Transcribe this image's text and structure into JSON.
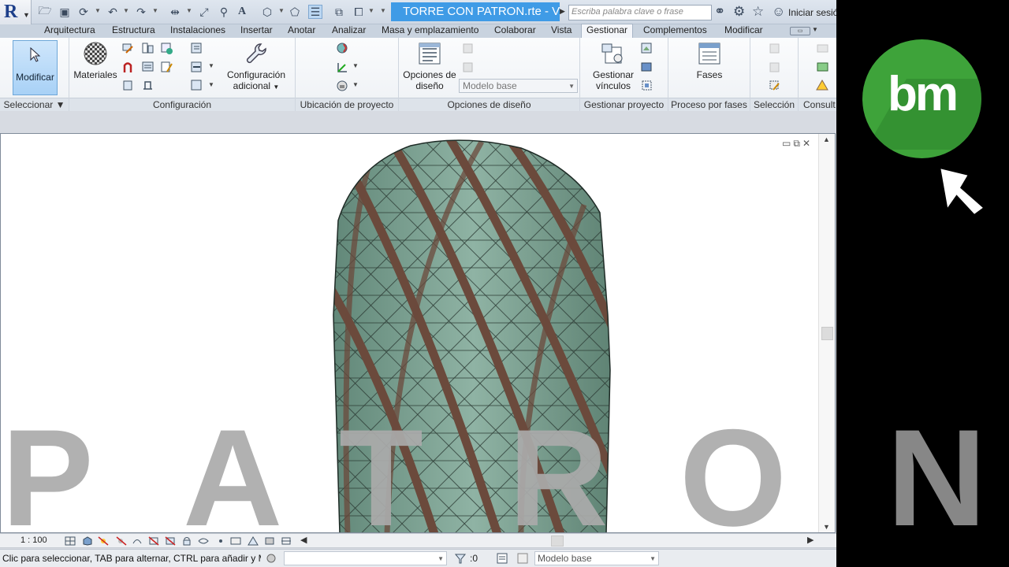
{
  "titlebar": {
    "doc_title": "TORRE CON PATRON.rte - V...",
    "search_placeholder": "Escriba palabra clave o frase",
    "signin_label": "Iniciar sesió"
  },
  "tabs": [
    {
      "label": "Arquitectura"
    },
    {
      "label": "Estructura"
    },
    {
      "label": "Instalaciones"
    },
    {
      "label": "Insertar"
    },
    {
      "label": "Anotar"
    },
    {
      "label": "Analizar"
    },
    {
      "label": "Masa y emplazamiento"
    },
    {
      "label": "Colaborar"
    },
    {
      "label": "Vista"
    },
    {
      "label": "Gestionar"
    },
    {
      "label": "Complementos"
    },
    {
      "label": "Modificar"
    }
  ],
  "active_tab": "Gestionar",
  "ribbon": {
    "modify_label": "Modificar",
    "materials_label": "Materiales",
    "config_extra_line1": "Configuración",
    "config_extra_line2": "adicional",
    "design_options_line1": "Opciones de",
    "design_options_line2": "diseño",
    "design_option_value": "Modelo base",
    "manage_links_line1": "Gestionar",
    "manage_links_line2": "vínculos",
    "phases_label": "Fases",
    "panels": {
      "select": "Seleccionar",
      "settings": "Configuración",
      "location": "Ubicación de proyecto",
      "design_options": "Opciones de diseño",
      "manage_project": "Gestionar proyecto",
      "phasing": "Proceso por fases",
      "selection": "Selección",
      "inquiry": "Consult"
    }
  },
  "overlay": {
    "letters": [
      "P",
      "A",
      "T",
      "R",
      "O",
      "N"
    ]
  },
  "viewbar": {
    "scale": "1 : 100"
  },
  "statusbar": {
    "message": "Clic para seleccionar, TAB para alternar, CTRL para añadir y M",
    "selection_count": ":0",
    "design_option": "Modelo base"
  },
  "brand": {
    "logo_text": "bm",
    "accent_color": "#3ea33a"
  },
  "colors": {
    "title_highlight": "#3f9be6",
    "glass": "#7fa596",
    "bands": "#6b4a3c"
  }
}
